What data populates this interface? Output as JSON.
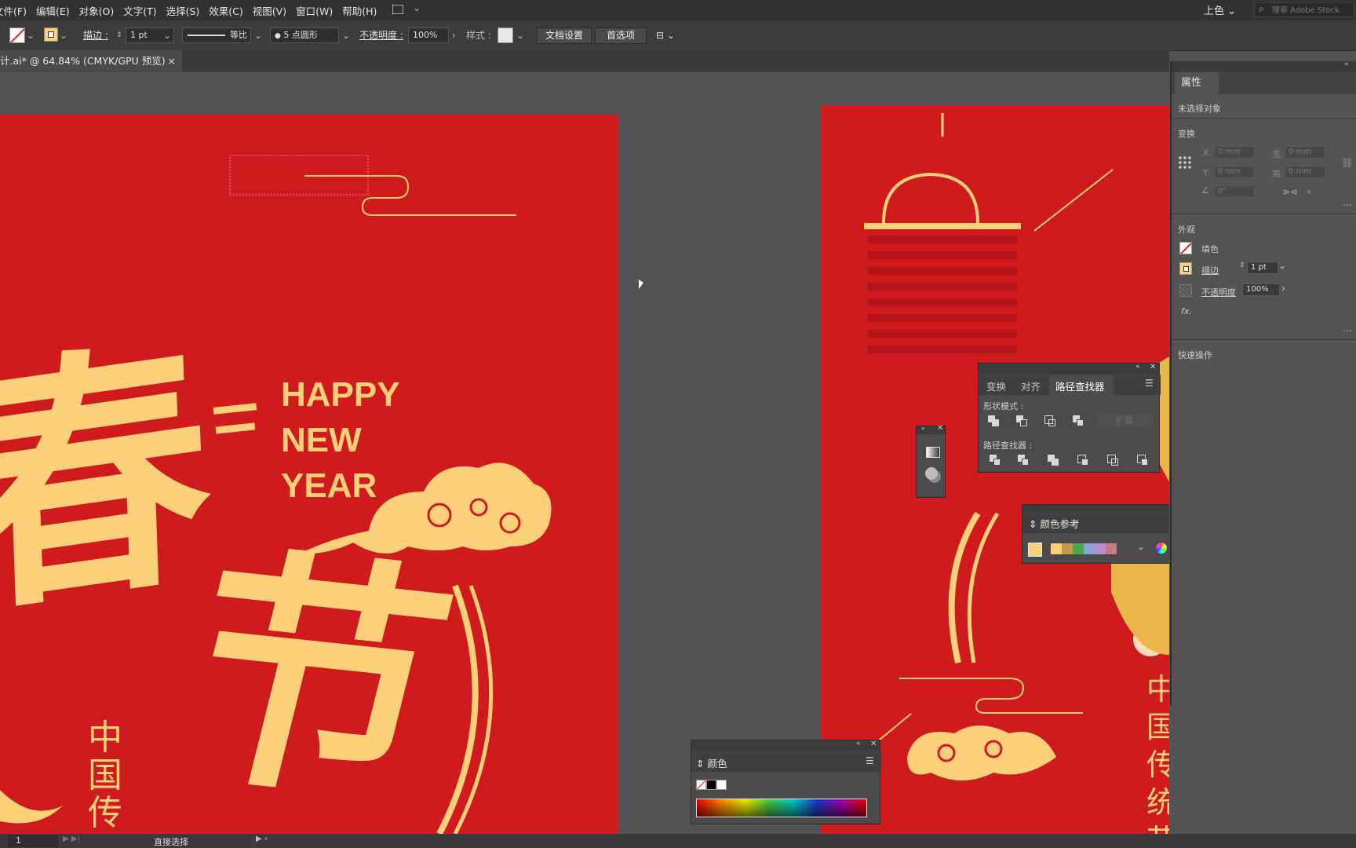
{
  "menubar": {
    "items": [
      "文件(F)",
      "编辑(E)",
      "对象(O)",
      "文字(T)",
      "选择(S)",
      "效果(C)",
      "视图(V)",
      "窗口(W)",
      "帮助(H)"
    ],
    "workspace": "上色",
    "search_placeholder": "搜索 Adobe Stock"
  },
  "controlbar": {
    "stroke_label": "描边 :",
    "stroke_value": "1 pt",
    "profile_label": "等比",
    "brush_label": "5 点圆形",
    "opacity_label": "不透明度 :",
    "opacity_value": "100%",
    "style_label": "样式 :",
    "doc_setup": "文档设置",
    "preferences": "首选项"
  },
  "document": {
    "tab_title": "计.ai* @ 64.84% (CMYK/GPU 预览)",
    "close": "×"
  },
  "artwork": {
    "happy": "HAPPY",
    "new": "NEW",
    "year": "YEAR",
    "char_chun": "春",
    "char_jie": "节",
    "vertical_left": "中国传",
    "vertical_right": "中国传统节",
    "colors": {
      "red": "#cf1a1e",
      "gold": "#fcd078"
    }
  },
  "properties_panel": {
    "tab": "属性",
    "no_selection": "未选择对象",
    "transform": "变换",
    "x_label": "X:",
    "y_label": "Y:",
    "w_label": "宽:",
    "h_label": "高:",
    "x_val": "0 mm",
    "y_val": "0 mm",
    "w_val": "0 mm",
    "h_val": "0 mm",
    "angle_val": "0°",
    "appearance": "外观",
    "fill": "填色",
    "stroke": "描边",
    "stroke_value": "1 pt",
    "opacity": "不透明度",
    "opacity_value": "100%",
    "fx": "fx.",
    "quick_actions": "快速操作"
  },
  "pathfinder_panel": {
    "tabs": [
      "变换",
      "对齐",
      "路径查找器"
    ],
    "shape_modes": "形状模式 :",
    "pathfinders": "路径查找器 :",
    "expand": "扩展"
  },
  "color_guide_panel": {
    "title": "颜色参考",
    "swatches": [
      "#fcd078",
      "#c49a4a",
      "#4aa84a",
      "#8aa0d8",
      "#b88ad0",
      "#c47a8a"
    ]
  },
  "color_panel": {
    "title": "颜色"
  },
  "statusbar": {
    "zoom": "1",
    "tool": "直接选择"
  }
}
